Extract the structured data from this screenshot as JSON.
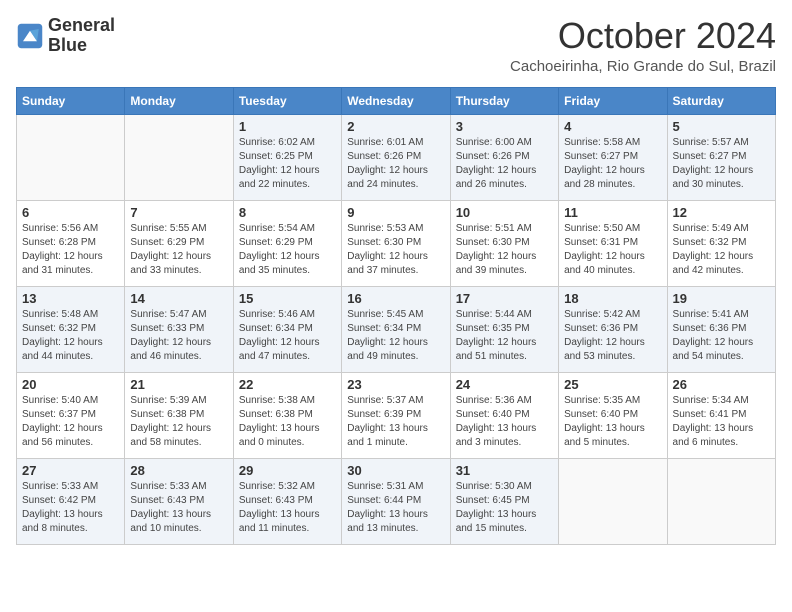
{
  "header": {
    "logo_line1": "General",
    "logo_line2": "Blue",
    "month": "October 2024",
    "location": "Cachoeirinha, Rio Grande do Sul, Brazil"
  },
  "weekdays": [
    "Sunday",
    "Monday",
    "Tuesday",
    "Wednesday",
    "Thursday",
    "Friday",
    "Saturday"
  ],
  "weeks": [
    [
      {
        "day": "",
        "info": ""
      },
      {
        "day": "",
        "info": ""
      },
      {
        "day": "1",
        "info": "Sunrise: 6:02 AM\nSunset: 6:25 PM\nDaylight: 12 hours and 22 minutes."
      },
      {
        "day": "2",
        "info": "Sunrise: 6:01 AM\nSunset: 6:26 PM\nDaylight: 12 hours and 24 minutes."
      },
      {
        "day": "3",
        "info": "Sunrise: 6:00 AM\nSunset: 6:26 PM\nDaylight: 12 hours and 26 minutes."
      },
      {
        "day": "4",
        "info": "Sunrise: 5:58 AM\nSunset: 6:27 PM\nDaylight: 12 hours and 28 minutes."
      },
      {
        "day": "5",
        "info": "Sunrise: 5:57 AM\nSunset: 6:27 PM\nDaylight: 12 hours and 30 minutes."
      }
    ],
    [
      {
        "day": "6",
        "info": "Sunrise: 5:56 AM\nSunset: 6:28 PM\nDaylight: 12 hours and 31 minutes."
      },
      {
        "day": "7",
        "info": "Sunrise: 5:55 AM\nSunset: 6:29 PM\nDaylight: 12 hours and 33 minutes."
      },
      {
        "day": "8",
        "info": "Sunrise: 5:54 AM\nSunset: 6:29 PM\nDaylight: 12 hours and 35 minutes."
      },
      {
        "day": "9",
        "info": "Sunrise: 5:53 AM\nSunset: 6:30 PM\nDaylight: 12 hours and 37 minutes."
      },
      {
        "day": "10",
        "info": "Sunrise: 5:51 AM\nSunset: 6:30 PM\nDaylight: 12 hours and 39 minutes."
      },
      {
        "day": "11",
        "info": "Sunrise: 5:50 AM\nSunset: 6:31 PM\nDaylight: 12 hours and 40 minutes."
      },
      {
        "day": "12",
        "info": "Sunrise: 5:49 AM\nSunset: 6:32 PM\nDaylight: 12 hours and 42 minutes."
      }
    ],
    [
      {
        "day": "13",
        "info": "Sunrise: 5:48 AM\nSunset: 6:32 PM\nDaylight: 12 hours and 44 minutes."
      },
      {
        "day": "14",
        "info": "Sunrise: 5:47 AM\nSunset: 6:33 PM\nDaylight: 12 hours and 46 minutes."
      },
      {
        "day": "15",
        "info": "Sunrise: 5:46 AM\nSunset: 6:34 PM\nDaylight: 12 hours and 47 minutes."
      },
      {
        "day": "16",
        "info": "Sunrise: 5:45 AM\nSunset: 6:34 PM\nDaylight: 12 hours and 49 minutes."
      },
      {
        "day": "17",
        "info": "Sunrise: 5:44 AM\nSunset: 6:35 PM\nDaylight: 12 hours and 51 minutes."
      },
      {
        "day": "18",
        "info": "Sunrise: 5:42 AM\nSunset: 6:36 PM\nDaylight: 12 hours and 53 minutes."
      },
      {
        "day": "19",
        "info": "Sunrise: 5:41 AM\nSunset: 6:36 PM\nDaylight: 12 hours and 54 minutes."
      }
    ],
    [
      {
        "day": "20",
        "info": "Sunrise: 5:40 AM\nSunset: 6:37 PM\nDaylight: 12 hours and 56 minutes."
      },
      {
        "day": "21",
        "info": "Sunrise: 5:39 AM\nSunset: 6:38 PM\nDaylight: 12 hours and 58 minutes."
      },
      {
        "day": "22",
        "info": "Sunrise: 5:38 AM\nSunset: 6:38 PM\nDaylight: 13 hours and 0 minutes."
      },
      {
        "day": "23",
        "info": "Sunrise: 5:37 AM\nSunset: 6:39 PM\nDaylight: 13 hours and 1 minute."
      },
      {
        "day": "24",
        "info": "Sunrise: 5:36 AM\nSunset: 6:40 PM\nDaylight: 13 hours and 3 minutes."
      },
      {
        "day": "25",
        "info": "Sunrise: 5:35 AM\nSunset: 6:40 PM\nDaylight: 13 hours and 5 minutes."
      },
      {
        "day": "26",
        "info": "Sunrise: 5:34 AM\nSunset: 6:41 PM\nDaylight: 13 hours and 6 minutes."
      }
    ],
    [
      {
        "day": "27",
        "info": "Sunrise: 5:33 AM\nSunset: 6:42 PM\nDaylight: 13 hours and 8 minutes."
      },
      {
        "day": "28",
        "info": "Sunrise: 5:33 AM\nSunset: 6:43 PM\nDaylight: 13 hours and 10 minutes."
      },
      {
        "day": "29",
        "info": "Sunrise: 5:32 AM\nSunset: 6:43 PM\nDaylight: 13 hours and 11 minutes."
      },
      {
        "day": "30",
        "info": "Sunrise: 5:31 AM\nSunset: 6:44 PM\nDaylight: 13 hours and 13 minutes."
      },
      {
        "day": "31",
        "info": "Sunrise: 5:30 AM\nSunset: 6:45 PM\nDaylight: 13 hours and 15 minutes."
      },
      {
        "day": "",
        "info": ""
      },
      {
        "day": "",
        "info": ""
      }
    ]
  ]
}
